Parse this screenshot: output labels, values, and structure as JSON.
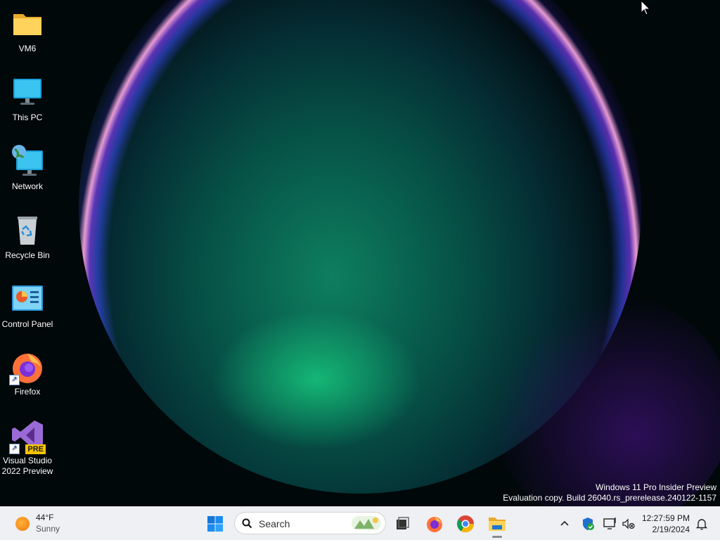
{
  "desktop": {
    "icons": [
      {
        "label": "VM6",
        "icon": "folder-icon"
      },
      {
        "label": "This PC",
        "icon": "monitor-icon"
      },
      {
        "label": "Network",
        "icon": "network-icon"
      },
      {
        "label": "Recycle Bin",
        "icon": "recycle-bin-icon"
      },
      {
        "label": "Control Panel",
        "icon": "control-panel-icon"
      },
      {
        "label": "Firefox",
        "icon": "firefox-icon"
      },
      {
        "label": "Visual Studio 2022 Preview",
        "icon": "visual-studio-icon",
        "badge": "PRE"
      }
    ],
    "watermark": {
      "line1": "Windows 11 Pro Insider Preview",
      "line2": "Evaluation copy. Build 26040.rs_prerelease.240122-1157"
    }
  },
  "taskbar": {
    "weather": {
      "temp": "44°F",
      "condition": "Sunny"
    },
    "search_label": "Search",
    "pinned": [
      "start-button",
      "task-view-button",
      "firefox-button",
      "chrome-button",
      "file-explorer-button"
    ],
    "clock": {
      "time": "12:27:59 PM",
      "date": "2/19/2024"
    }
  }
}
